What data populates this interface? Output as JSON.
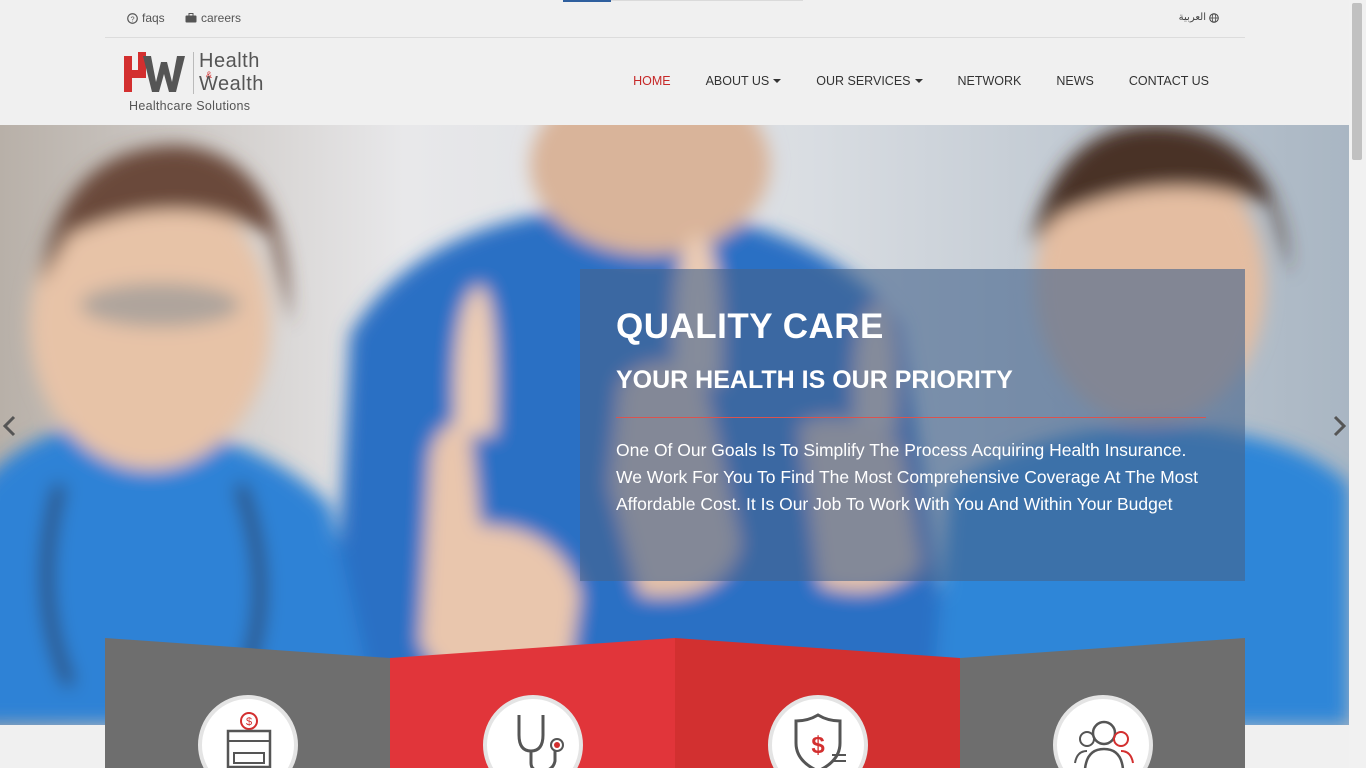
{
  "topbar": {
    "faqs_label": "faqs",
    "careers_label": "careers",
    "language_label": "العربية"
  },
  "logo": {
    "line1": "Health",
    "amp": "&",
    "line2": "Wealth",
    "tagline": "Healthcare Solutions",
    "brand_red": "#d32f2f"
  },
  "nav": {
    "items": [
      {
        "label": "HOME",
        "active": true
      },
      {
        "label": "ABOUT US",
        "dropdown": true
      },
      {
        "label": "OUR SERVICES",
        "dropdown": true
      },
      {
        "label": "NETWORK"
      },
      {
        "label": "NEWS"
      },
      {
        "label": "CONTACT US"
      }
    ]
  },
  "hero": {
    "title": "QUALITY CARE",
    "subtitle": "YOUR HEALTH IS OUR PRIORITY",
    "body": "One Of Our Goals Is To Simplify The Process Acquiring Health Insurance. We Work For You To Find The Most Comprehensive Coverage At The Most Affordable Cost. It Is Our Job To Work With You And Within Your Budget"
  },
  "features": [
    {
      "icon": "payment-box-icon",
      "color": "#6e6e6e"
    },
    {
      "icon": "stethoscope-icon",
      "color": "#e1353a"
    },
    {
      "icon": "shield-dollar-icon",
      "color": "#d23030"
    },
    {
      "icon": "people-icon",
      "color": "#6e6e6e"
    }
  ]
}
